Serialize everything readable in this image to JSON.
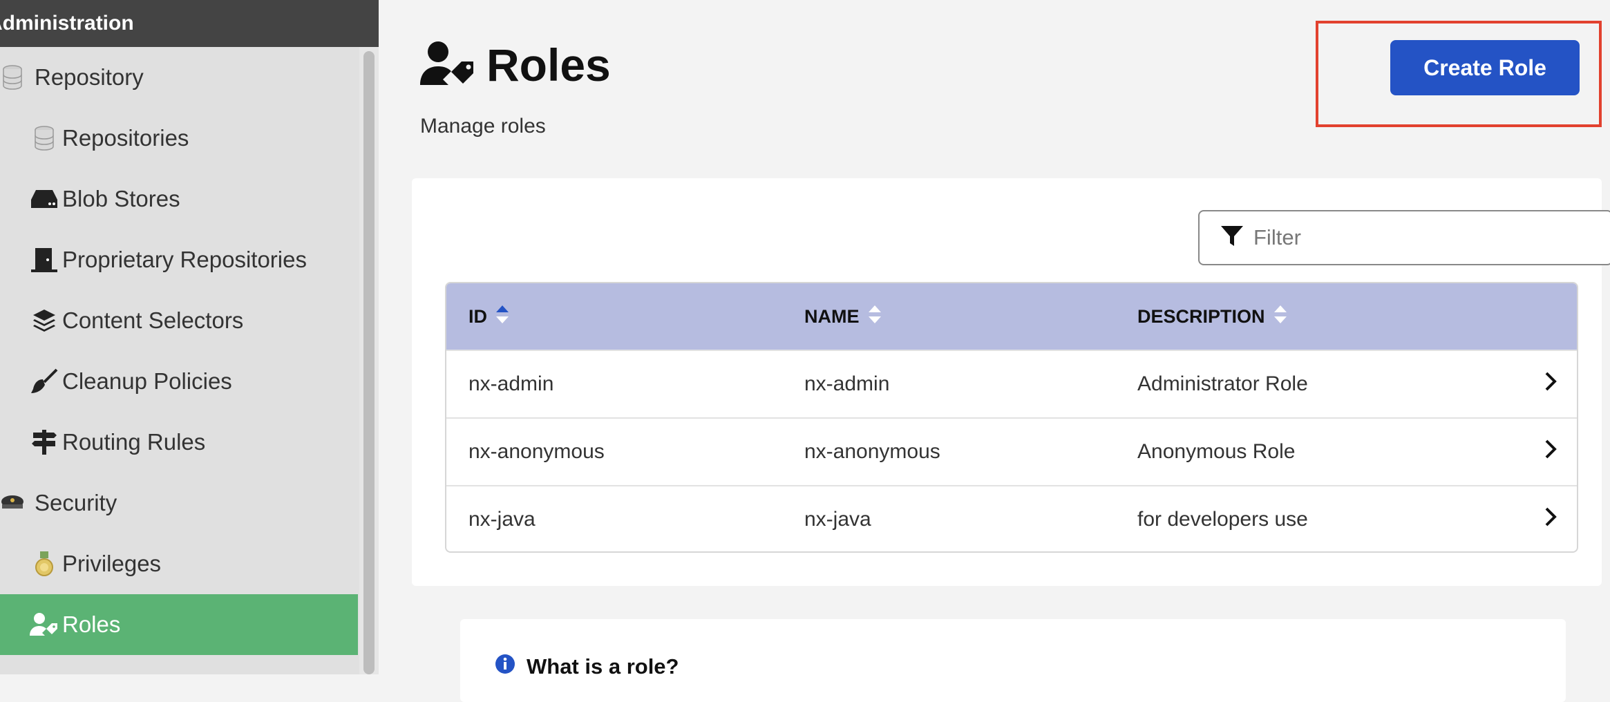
{
  "sidebar": {
    "header": "Administration",
    "items": [
      {
        "label": "Repository",
        "icon": "database-icon",
        "level": 1
      },
      {
        "label": "Repositories",
        "icon": "database-icon",
        "level": 2
      },
      {
        "label": "Blob Stores",
        "icon": "hard-drive-icon",
        "level": 2
      },
      {
        "label": "Proprietary Repositories",
        "icon": "door-icon",
        "level": 2
      },
      {
        "label": "Content Selectors",
        "icon": "layers-icon",
        "level": 2
      },
      {
        "label": "Cleanup Policies",
        "icon": "broom-icon",
        "level": 2
      },
      {
        "label": "Routing Rules",
        "icon": "signpost-icon",
        "level": 2
      },
      {
        "label": "Security",
        "icon": "police-cap-icon",
        "level": 1
      },
      {
        "label": "Privileges",
        "icon": "medal-icon",
        "level": 2
      },
      {
        "label": "Roles",
        "icon": "user-tag-icon",
        "level": 2,
        "active": true
      }
    ]
  },
  "page": {
    "title": "Roles",
    "subtitle": "Manage roles",
    "create_button": "Create Role"
  },
  "filter": {
    "placeholder": "Filter"
  },
  "table": {
    "columns": [
      "ID",
      "NAME",
      "DESCRIPTION"
    ],
    "rows": [
      {
        "id": "nx-admin",
        "name": "nx-admin",
        "description": "Administrator Role"
      },
      {
        "id": "nx-anonymous",
        "name": "nx-anonymous",
        "description": "Anonymous Role"
      },
      {
        "id": "nx-java",
        "name": "nx-java",
        "description": "for developers use"
      }
    ]
  },
  "info": {
    "title": "What is a role?"
  },
  "colors": {
    "primary": "#2453c5",
    "active_nav": "#5bb374",
    "table_header": "#b6bce0",
    "highlight": "#e2412e",
    "sidebar_header": "#444444"
  }
}
